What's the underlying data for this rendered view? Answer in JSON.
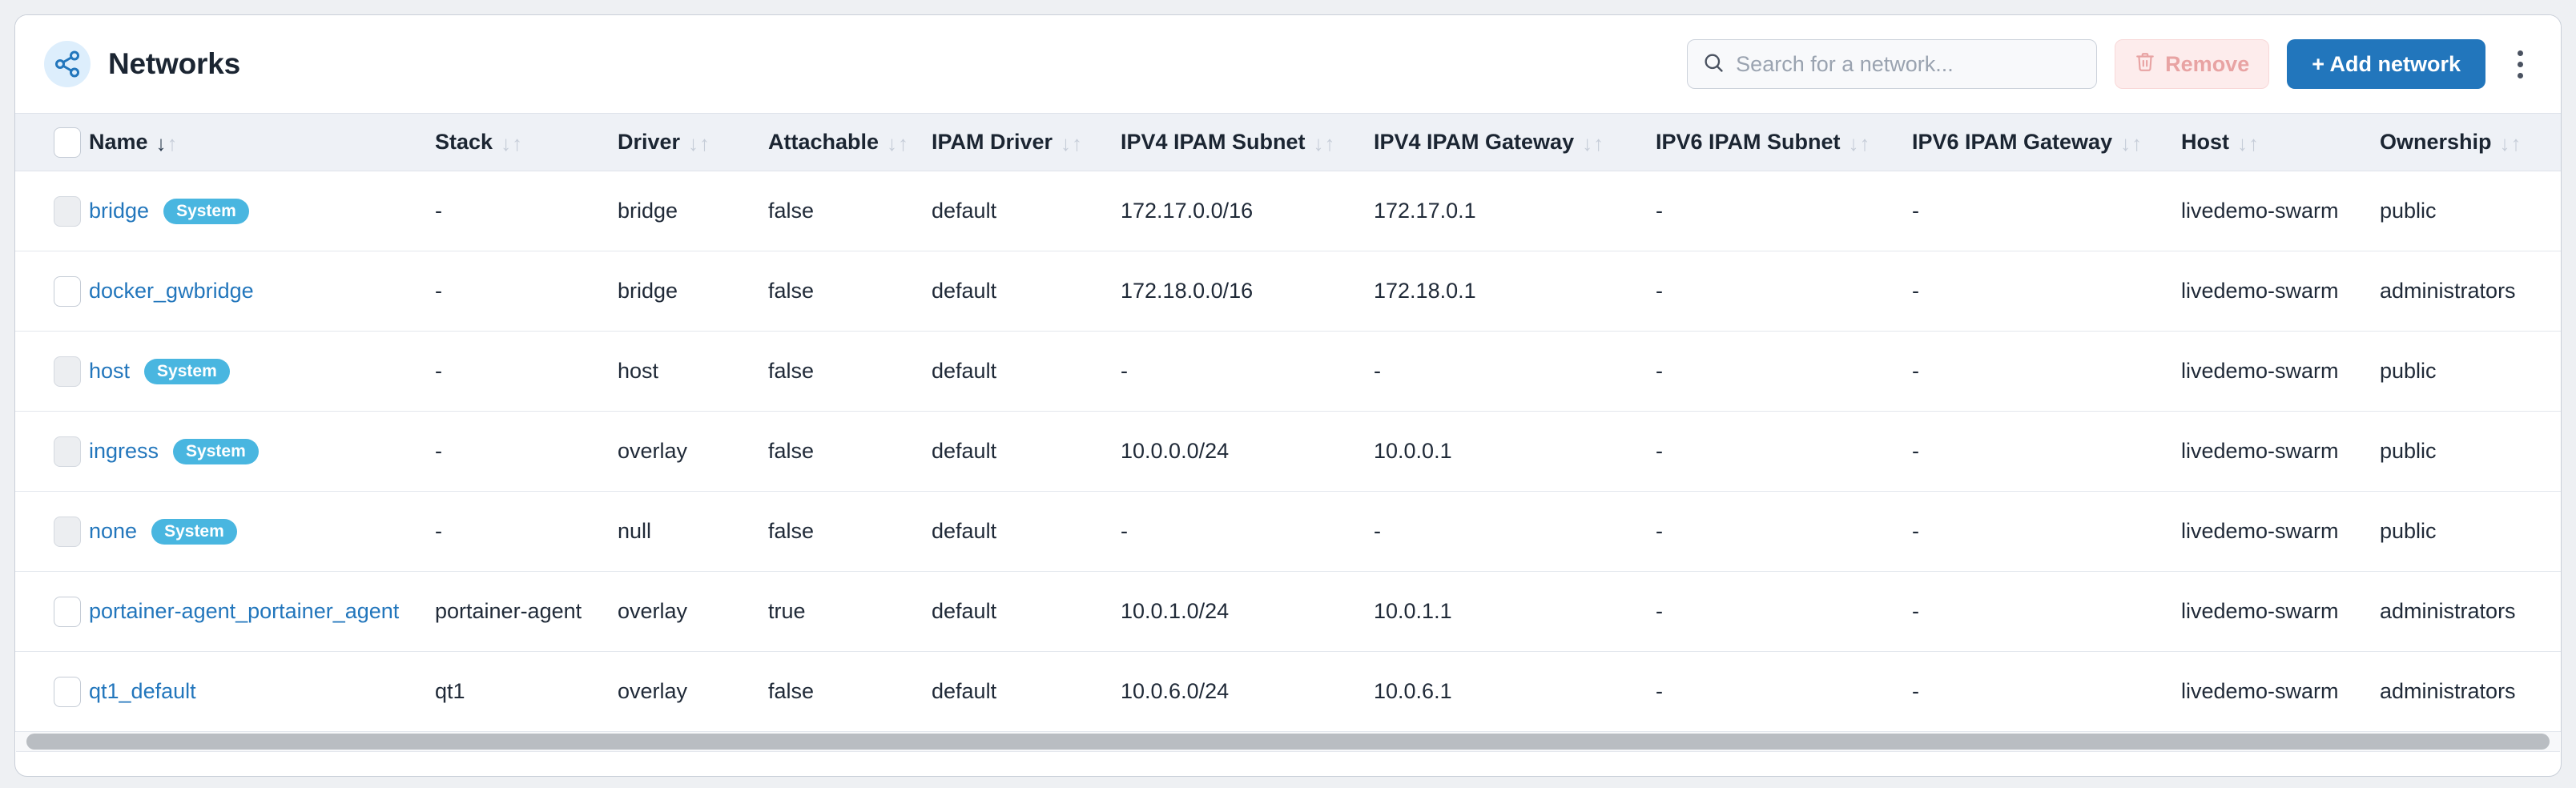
{
  "header": {
    "title": "Networks",
    "icon": "network-share-icon",
    "search": {
      "placeholder": "Search for a network...",
      "value": "",
      "icon": "search-icon"
    },
    "remove_button": {
      "label": "Remove",
      "icon": "trash-icon"
    },
    "add_button": {
      "label": "+ Add network"
    },
    "kebab": {
      "icon": "kebab-menu-icon"
    }
  },
  "colors": {
    "accent": "#2276bc",
    "link": "#2276bc",
    "badge": "#49b6e0",
    "remove_bg": "#fdecec",
    "remove_text": "#e8a3a3",
    "header_row_bg": "#eef1f6",
    "page_bg": "#eef0f3"
  },
  "table": {
    "columns": [
      {
        "label": "Name",
        "sortable": true,
        "sorted": "desc",
        "key": "name"
      },
      {
        "label": "Stack",
        "sortable": true,
        "sorted": "none",
        "key": "stack"
      },
      {
        "label": "Driver",
        "sortable": true,
        "sorted": "none",
        "key": "driver"
      },
      {
        "label": "Attachable",
        "sortable": true,
        "sorted": "none",
        "key": "attachable"
      },
      {
        "label": "IPAM Driver",
        "sortable": true,
        "sorted": "none",
        "key": "ipam_driver"
      },
      {
        "label": "IPV4 IPAM Subnet",
        "sortable": true,
        "sorted": "none",
        "key": "ipv4_subnet"
      },
      {
        "label": "IPV4 IPAM Gateway",
        "sortable": true,
        "sorted": "none",
        "key": "ipv4_gateway"
      },
      {
        "label": "IPV6 IPAM Subnet",
        "sortable": true,
        "sorted": "none",
        "key": "ipv6_subnet"
      },
      {
        "label": "IPV6 IPAM Gateway",
        "sortable": true,
        "sorted": "none",
        "key": "ipv6_gateway"
      },
      {
        "label": "Host",
        "sortable": true,
        "sorted": "none",
        "key": "host"
      },
      {
        "label": "Ownership",
        "sortable": true,
        "sorted": "none",
        "key": "ownership"
      }
    ],
    "select_all_checked": false,
    "rows": [
      {
        "name": "bridge",
        "badge": "System",
        "checkbox_disabled": true,
        "stack": "-",
        "driver": "bridge",
        "attachable": "false",
        "ipam_driver": "default",
        "ipv4_subnet": "172.17.0.0/16",
        "ipv4_gateway": "172.17.0.1",
        "ipv6_subnet": "-",
        "ipv6_gateway": "-",
        "host": "livedemo-swarm",
        "ownership": "public"
      },
      {
        "name": "docker_gwbridge",
        "badge": null,
        "checkbox_disabled": false,
        "stack": "-",
        "driver": "bridge",
        "attachable": "false",
        "ipam_driver": "default",
        "ipv4_subnet": "172.18.0.0/16",
        "ipv4_gateway": "172.18.0.1",
        "ipv6_subnet": "-",
        "ipv6_gateway": "-",
        "host": "livedemo-swarm",
        "ownership": "administrators"
      },
      {
        "name": "host",
        "badge": "System",
        "checkbox_disabled": true,
        "stack": "-",
        "driver": "host",
        "attachable": "false",
        "ipam_driver": "default",
        "ipv4_subnet": "-",
        "ipv4_gateway": "-",
        "ipv6_subnet": "-",
        "ipv6_gateway": "-",
        "host": "livedemo-swarm",
        "ownership": "public"
      },
      {
        "name": "ingress",
        "badge": "System",
        "checkbox_disabled": true,
        "stack": "-",
        "driver": "overlay",
        "attachable": "false",
        "ipam_driver": "default",
        "ipv4_subnet": "10.0.0.0/24",
        "ipv4_gateway": "10.0.0.1",
        "ipv6_subnet": "-",
        "ipv6_gateway": "-",
        "host": "livedemo-swarm",
        "ownership": "public"
      },
      {
        "name": "none",
        "badge": "System",
        "checkbox_disabled": true,
        "stack": "-",
        "driver": "null",
        "attachable": "false",
        "ipam_driver": "default",
        "ipv4_subnet": "-",
        "ipv4_gateway": "-",
        "ipv6_subnet": "-",
        "ipv6_gateway": "-",
        "host": "livedemo-swarm",
        "ownership": "public"
      },
      {
        "name": "portainer-agent_portainer_agent",
        "badge": null,
        "checkbox_disabled": false,
        "stack": "portainer-agent",
        "driver": "overlay",
        "attachable": "true",
        "ipam_driver": "default",
        "ipv4_subnet": "10.0.1.0/24",
        "ipv4_gateway": "10.0.1.1",
        "ipv6_subnet": "-",
        "ipv6_gateway": "-",
        "host": "livedemo-swarm",
        "ownership": "administrators"
      },
      {
        "name": "qt1_default",
        "badge": null,
        "checkbox_disabled": false,
        "stack": "qt1",
        "driver": "overlay",
        "attachable": "false",
        "ipam_driver": "default",
        "ipv4_subnet": "10.0.6.0/24",
        "ipv4_gateway": "10.0.6.1",
        "ipv6_subnet": "-",
        "ipv6_gateway": "-",
        "host": "livedemo-swarm",
        "ownership": "administrators"
      }
    ]
  },
  "scrollbar": {
    "orientation": "horizontal",
    "thumb_fraction": 0.99
  }
}
